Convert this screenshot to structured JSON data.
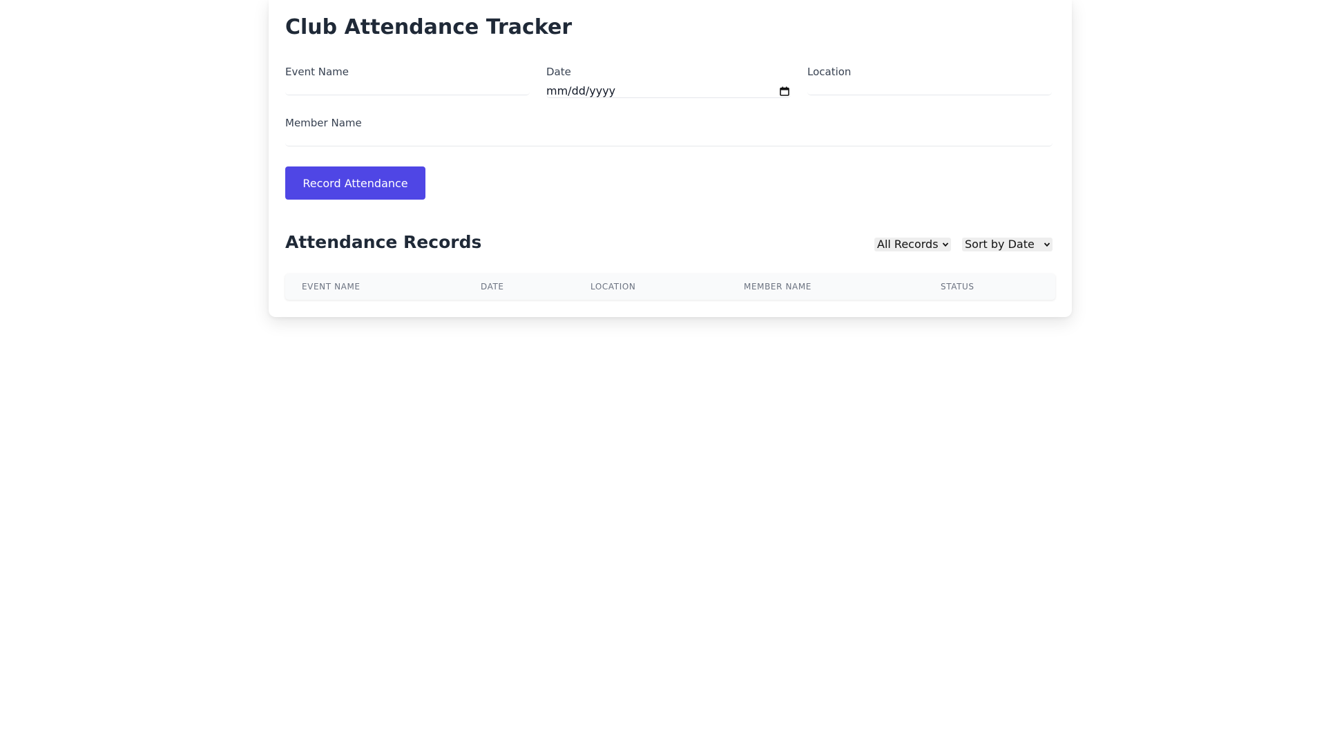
{
  "app": {
    "title": "Club Attendance Tracker"
  },
  "form": {
    "event_name": {
      "label": "Event Name",
      "value": "",
      "placeholder": ""
    },
    "date": {
      "label": "Date",
      "placeholder_text": "mm/dd/yyyy"
    },
    "location": {
      "label": "Location",
      "value": "",
      "placeholder": ""
    },
    "member_name": {
      "label": "Member Name",
      "value": "",
      "placeholder": ""
    },
    "submit_label": "Record Attendance"
  },
  "records": {
    "title": "Attendance Records",
    "filter_select": {
      "selected": "All Records"
    },
    "sort_select": {
      "selected": "Sort by Date"
    },
    "columns": [
      "Event Name",
      "Date",
      "Location",
      "Member Name",
      "Status"
    ],
    "rows": []
  },
  "colors": {
    "accent": "#4f46e5",
    "heading": "#1f2937",
    "label": "#374151",
    "table_header_text": "#6b7280",
    "table_header_bg": "#f9fafb"
  },
  "icons": {
    "date_picker": "calendar-icon",
    "select_arrow": "chevron-down-icon"
  }
}
